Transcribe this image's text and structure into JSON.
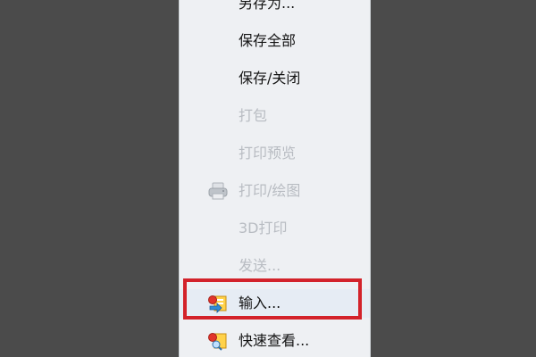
{
  "menu": {
    "items": [
      {
        "label": "另存为...",
        "enabled": true
      },
      {
        "label": "保存全部",
        "enabled": true
      },
      {
        "label": "保存/关闭",
        "enabled": true
      },
      {
        "label": "打包",
        "enabled": false
      },
      {
        "label": "打印预览",
        "enabled": false
      },
      {
        "label": "打印/绘图",
        "enabled": false,
        "icon": "printer-icon"
      },
      {
        "label": "3D打印",
        "enabled": false
      },
      {
        "label": "发送...",
        "enabled": false
      },
      {
        "label": "输入...",
        "enabled": true,
        "icon": "import-icon",
        "highlighted": true
      },
      {
        "label": "快速查看...",
        "enabled": true,
        "icon": "quick-view-icon"
      }
    ]
  },
  "colors": {
    "background": "#4b4b4b",
    "menu_bg": "#eef0f3",
    "text": "#141414",
    "disabled_text": "#b8bcc2",
    "highlight_border": "#d3222a"
  }
}
